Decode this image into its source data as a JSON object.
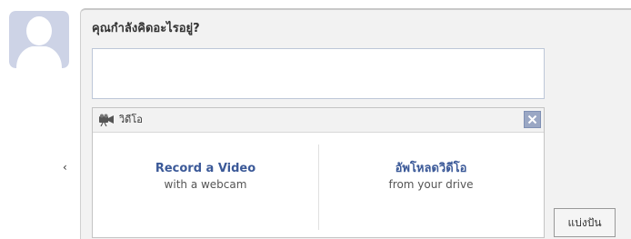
{
  "composer": {
    "prompt": "คุณกำลังคิดอะไรอยู่?",
    "status_value": ""
  },
  "stray_text": "‹",
  "video_panel": {
    "icon": "video-camera-icon",
    "title": "วิดีโอ",
    "close_icon": "close-icon",
    "options": [
      {
        "title": "Record a Video",
        "subtitle": "with a webcam"
      },
      {
        "title": "อัพโหลดวิดีโอ",
        "subtitle": "from your drive"
      }
    ]
  },
  "share_button": {
    "label": "แบ่งปัน"
  },
  "colors": {
    "link_blue": "#3b5998",
    "panel_gray": "#f2f2f2",
    "avatar_blue": "#cdd3e6",
    "close_button": "#9aa7c4"
  }
}
